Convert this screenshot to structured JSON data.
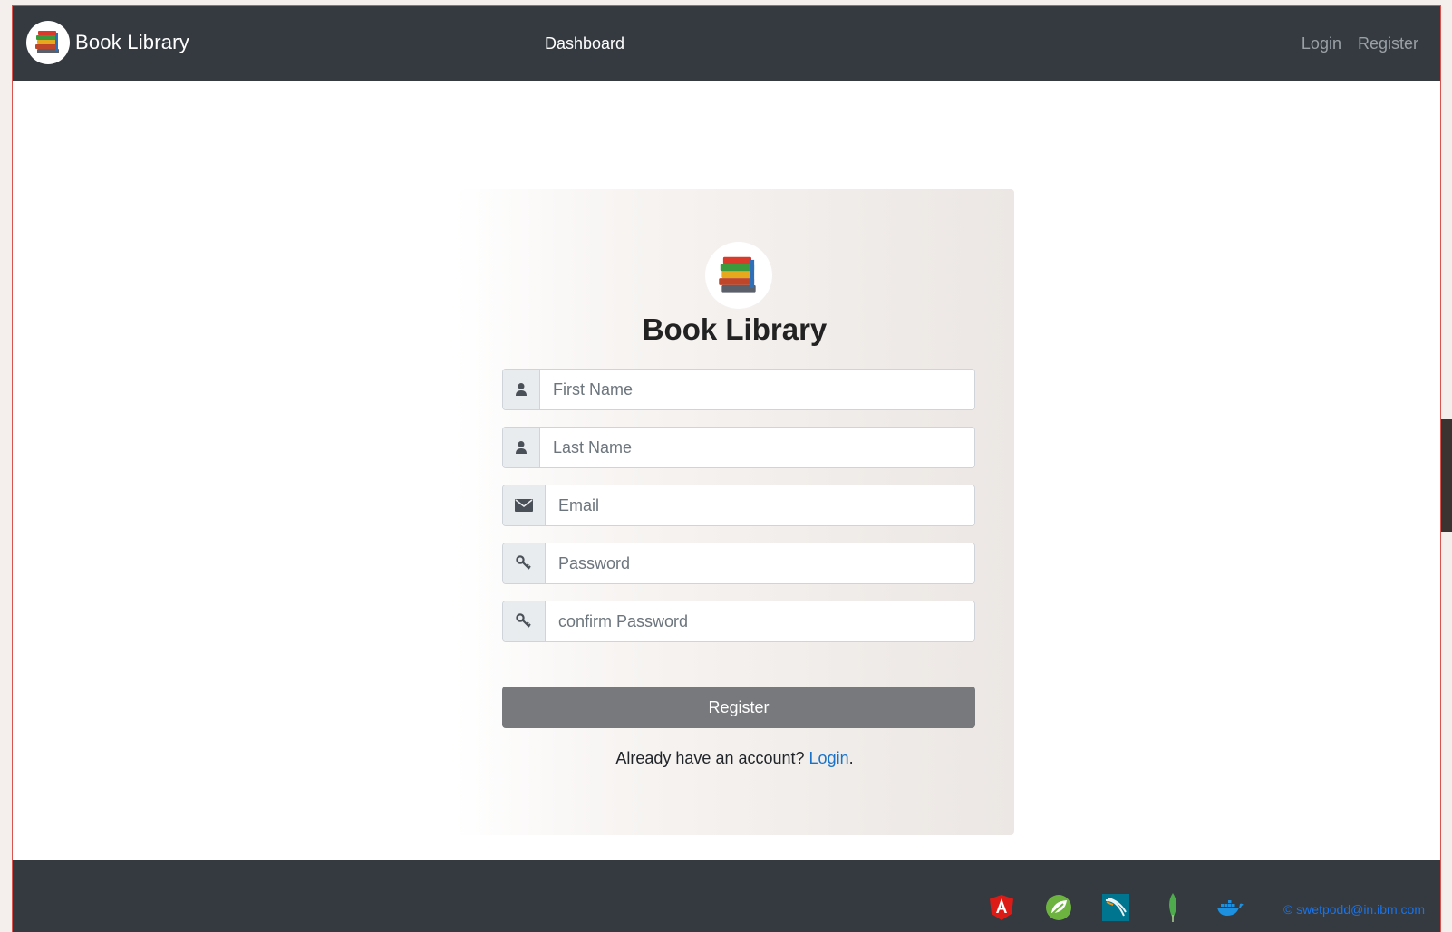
{
  "navbar": {
    "brand": "Book Library",
    "dashboard": "Dashboard",
    "login": "Login",
    "register": "Register"
  },
  "form": {
    "title": "Book Library",
    "first_name_placeholder": "First Name",
    "last_name_placeholder": "Last Name",
    "email_placeholder": "Email",
    "password_placeholder": "Password",
    "confirm_password_placeholder": "confirm Password",
    "submit": "Register",
    "already_text": "Already have an account?",
    "login_link": "Login",
    "period": "."
  },
  "footer": {
    "email": "© swetpodd@in.ibm.com",
    "icons": [
      "angular-icon",
      "spring-icon",
      "mysql-icon",
      "mongodb-icon",
      "docker-icon"
    ]
  },
  "colors": {
    "navbar": "#343a40",
    "button": "#77797c",
    "link": "#1a73c8"
  }
}
